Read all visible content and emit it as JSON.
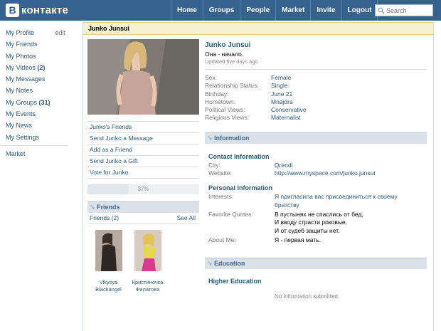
{
  "header": {
    "logo_badge": "B",
    "logo_text": "контакте",
    "nav": [
      "Home",
      "Groups",
      "People",
      "Market",
      "Invite",
      "Logout"
    ],
    "search_placeholder": "Search"
  },
  "left_menu": {
    "items": [
      {
        "label": "My Profile",
        "extra": "edit"
      },
      {
        "label": "My Friends"
      },
      {
        "label": "My Photos"
      },
      {
        "label": "My Videos",
        "count": "(2)"
      },
      {
        "label": "My Messages"
      },
      {
        "label": "My Notes"
      },
      {
        "label": "My Groups",
        "count": "(31)"
      },
      {
        "label": "My Events"
      },
      {
        "label": "My News"
      },
      {
        "label": "My Settings"
      }
    ],
    "market": "Market"
  },
  "title_bar": "Junko Junsui",
  "actions": [
    "Junko's Friends",
    "Send Junko a Message",
    "Add as a Friend",
    "Send Junko a Gift",
    "Vote for Junko"
  ],
  "rating": {
    "text": "37%",
    "percent": 37
  },
  "friends": {
    "heading": "Friends",
    "subheading": "Friends (2)",
    "see_all": "See All",
    "list": [
      {
        "name_line1": "Vikysya",
        "name_line2": "Blackangel"
      },
      {
        "name_line1": "Кристиночка",
        "name_line2": "Филатова"
      }
    ]
  },
  "profile": {
    "name": "Junko Junsui",
    "status": "Она - начало.",
    "updated": "Updated five days ago",
    "basic": [
      {
        "label": "Sex:",
        "value": "Female"
      },
      {
        "label": "Relationship Status:",
        "value": "Single"
      },
      {
        "label": "Birthday:",
        "value": "June 21"
      },
      {
        "label": "Hometown:",
        "value": "Mnajdra"
      },
      {
        "label": "Political Views:",
        "value": "Conservative"
      },
      {
        "label": "Religious Views:",
        "value": "Maternalist"
      }
    ]
  },
  "information": {
    "heading": "Information",
    "contact_title": "Contact Information",
    "contact": [
      {
        "label": "City:",
        "value": "Qrendi"
      },
      {
        "label": "Website:",
        "value": "http://www.myspace.com/junko.junsui"
      }
    ],
    "personal_title": "Personal Information",
    "interests_label": "Interests:",
    "interests": [
      "Я пригласила вас присоединиться к своему",
      "братству"
    ],
    "quotes_label": "Favorite Quotes:",
    "quotes": [
      "В пустынях не спаслись от бед,",
      "И вводу страсти роковые,",
      "И от судеб защиты нет."
    ],
    "about_label": "About Me:",
    "about": "Я - первая мать."
  },
  "education": {
    "heading": "Education",
    "sub": "Higher Education",
    "none": "No information submitted."
  },
  "colors": {
    "header": "#36638e",
    "link": "#2b587a",
    "section": "#dae1e8",
    "title_bar": "#f7f1cf"
  }
}
